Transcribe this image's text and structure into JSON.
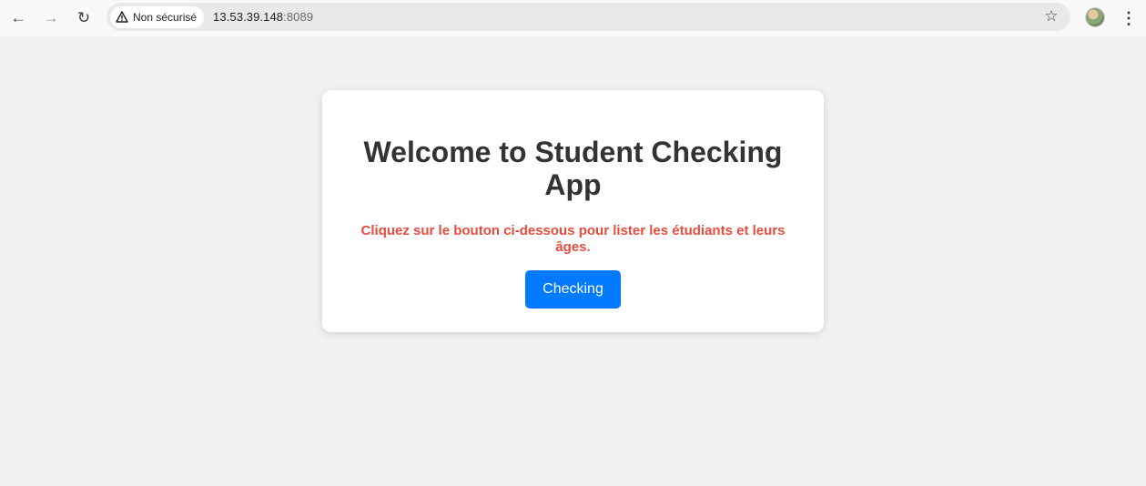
{
  "browser": {
    "back_icon": "←",
    "forward_icon": "→",
    "reload_icon": "↻",
    "security_label": "Non sécurisé",
    "url_host": "13.53.39.148",
    "url_port": ":8089",
    "star_icon": "☆",
    "menu_icon": "⋮"
  },
  "card": {
    "title": "Welcome to Student Checking App",
    "subtitle": "Cliquez sur le bouton ci-dessous pour lister les étudiants et leurs âges.",
    "button_label": "Checking"
  },
  "colors": {
    "page_bg": "#f1f1f1",
    "title": "#333333",
    "subtitle": "#e74c3c",
    "button": "#007bff"
  }
}
